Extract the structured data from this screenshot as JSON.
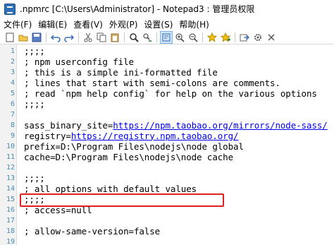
{
  "window": {
    "title": ".npmrc [C:\\Users\\Administrator] - Notepad3 : 管理员权限"
  },
  "menu": [
    "文件(F)",
    "编辑(E)",
    "查看(V)",
    "外观(P)",
    "设置(S)",
    "帮助(H)"
  ],
  "toolbar": {
    "icons": [
      "new-file-icon",
      "open-folder-icon",
      "save-icon",
      "undo-icon",
      "redo-icon",
      "cut-icon",
      "copy-icon",
      "paste-icon",
      "find-icon",
      "replace-icon",
      "word-wrap-icon",
      "zoom-in-icon",
      "zoom-out-icon",
      "favorites-icon",
      "add-favorite-icon",
      "export-icon",
      "settings-icon",
      "close-icon"
    ]
  },
  "editor": {
    "lines": [
      {
        "n": "1",
        "text": ";;;;"
      },
      {
        "n": "2",
        "text": "; npm userconfig file"
      },
      {
        "n": "3",
        "text": "; this is a simple ini-formatted file"
      },
      {
        "n": "4",
        "text": "; lines that start with semi-colons are comments."
      },
      {
        "n": "5",
        "text": "; read `npm help config` for help on the various options"
      },
      {
        "n": "6",
        "text": ";;;;"
      },
      {
        "n": "7",
        "text": ""
      },
      {
        "n": "8",
        "key": "sass_binary_site=",
        "url": "https://npm.taobao.org/mirrors/node-sass/"
      },
      {
        "n": "9",
        "key": "registry=",
        "url": "https://registry.npm.taobao.org/"
      },
      {
        "n": "10",
        "text": "prefix=D:\\Program Files\\nodejs\\node global"
      },
      {
        "n": "11",
        "text": "cache=D:\\Program Files\\nodejs\\node cache"
      },
      {
        "n": "12",
        "text": ""
      },
      {
        "n": "13",
        "text": ";;;;"
      },
      {
        "n": "14",
        "text": "; all options with default values"
      },
      {
        "n": "15",
        "text": ";;;;"
      },
      {
        "n": "16",
        "text": "; access=null"
      },
      {
        "n": "17",
        "text": ""
      },
      {
        "n": "18",
        "text": "; allow-same-version=false"
      },
      {
        "n": "19",
        "text": ""
      }
    ],
    "highlight_color": "#e02020"
  }
}
